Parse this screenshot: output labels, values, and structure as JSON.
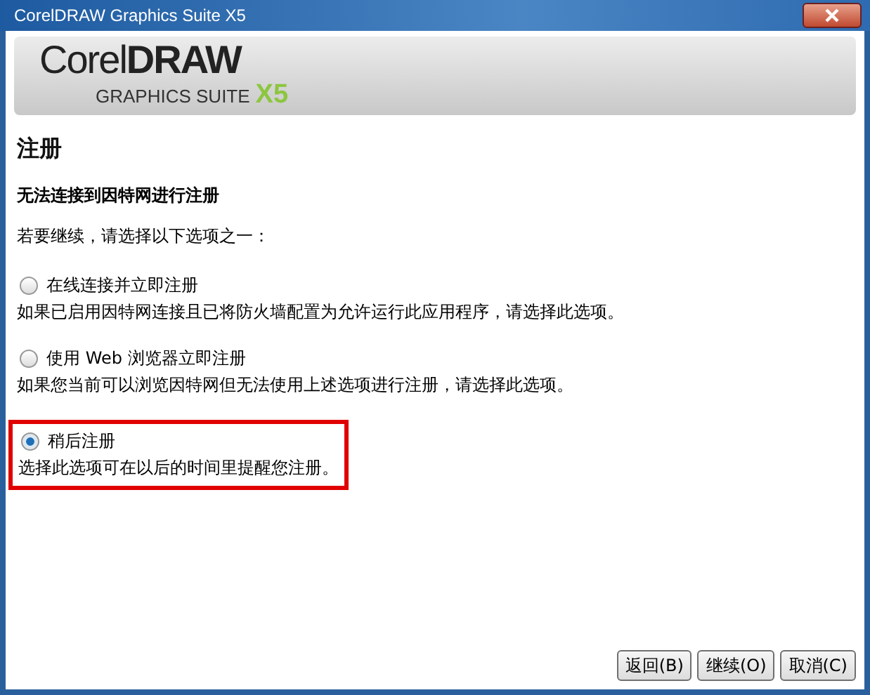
{
  "window": {
    "title": "CorelDRAW Graphics Suite X5"
  },
  "banner": {
    "brand_light": "Corel",
    "brand_bold": "DRAW",
    "suite": "GRAPHICS SUITE",
    "version": "X5"
  },
  "heading": "注册",
  "subheading": "无法连接到因特网进行注册",
  "prompt": "若要继续，请选择以下选项之一：",
  "options": [
    {
      "label": "在线连接并立即注册",
      "description": "如果已启用因特网连接且已将防火墙配置为允许运行此应用程序，请选择此选项。",
      "selected": false,
      "highlighted": false
    },
    {
      "label": "使用 Web 浏览器立即注册",
      "description": "如果您当前可以浏览因特网但无法使用上述选项进行注册，请选择此选项。",
      "selected": false,
      "highlighted": false
    },
    {
      "label": "稍后注册",
      "description": "选择此选项可在以后的时间里提醒您注册。",
      "selected": true,
      "highlighted": true
    }
  ],
  "buttons": [
    "返回(B)",
    "继续(O)",
    "取消(C)"
  ]
}
